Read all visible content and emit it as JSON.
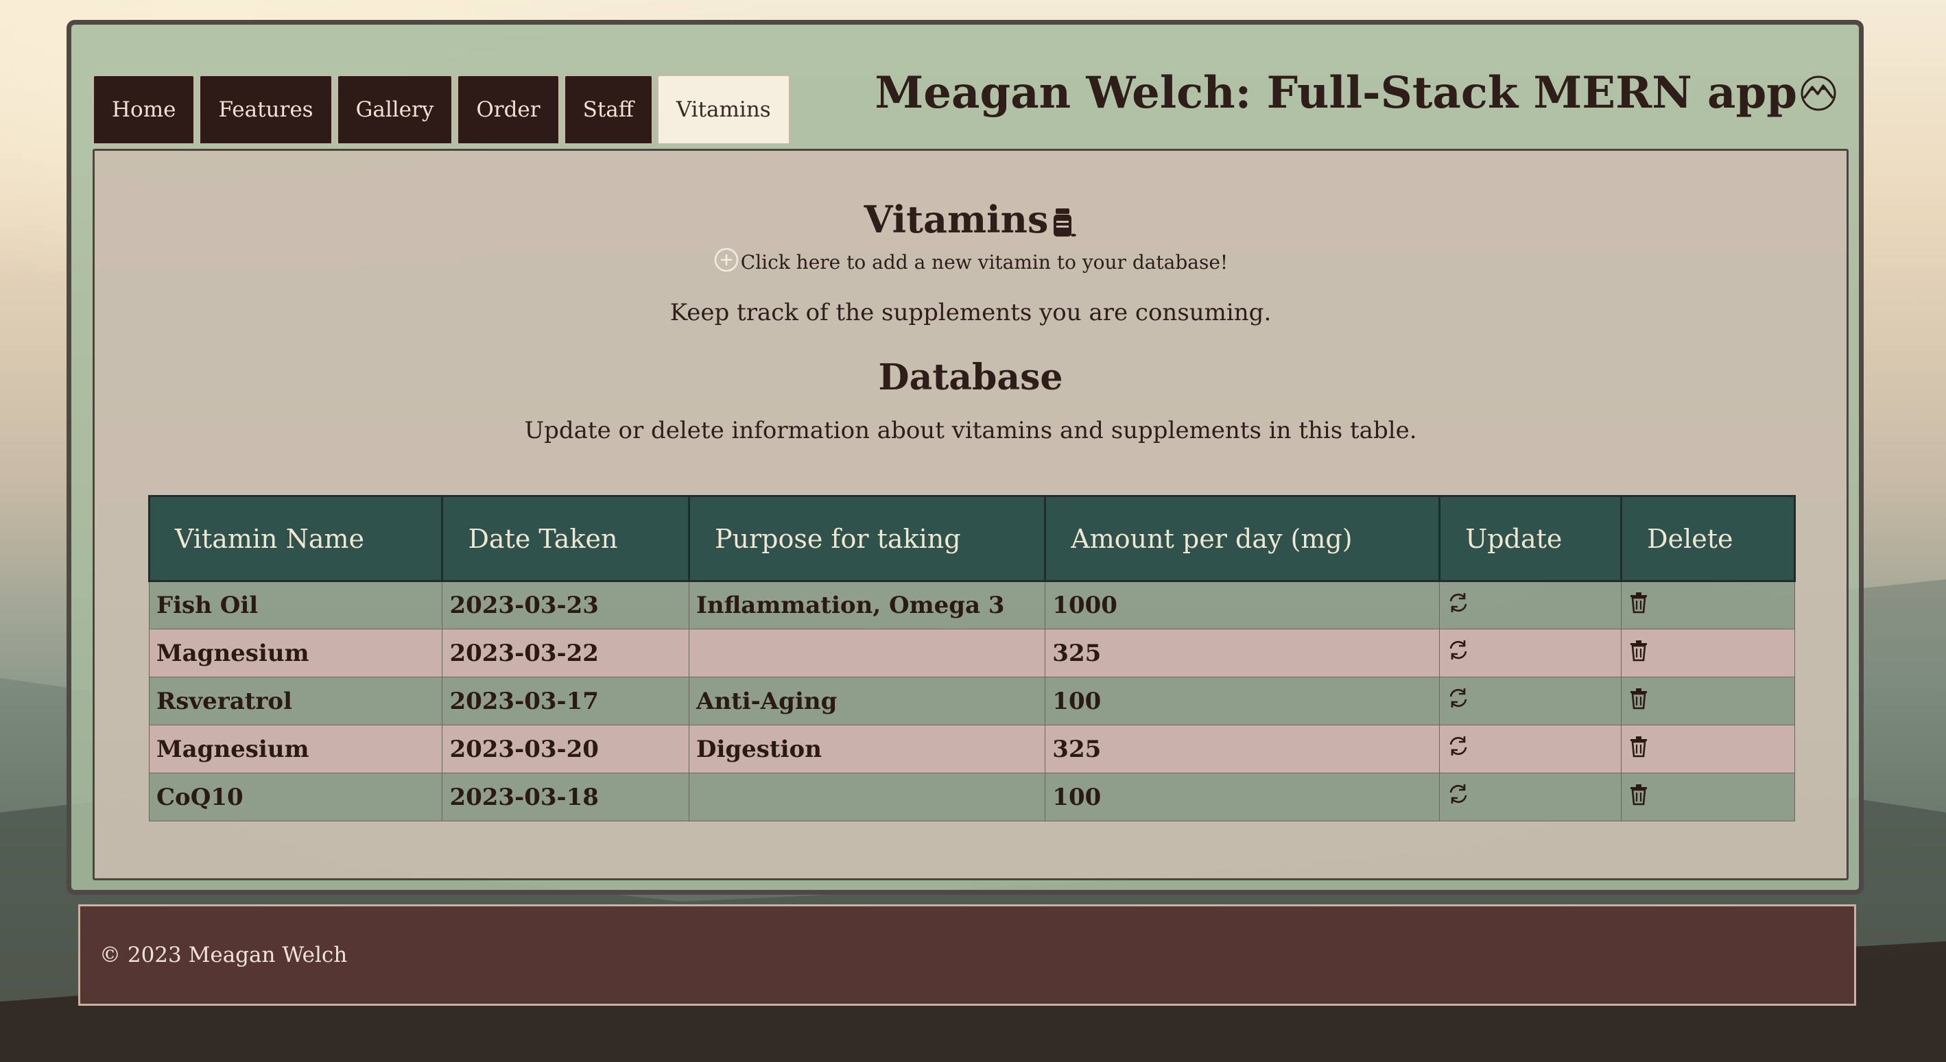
{
  "nav": {
    "tabs": [
      {
        "label": "Home"
      },
      {
        "label": "Features"
      },
      {
        "label": "Gallery"
      },
      {
        "label": "Order"
      },
      {
        "label": "Staff"
      },
      {
        "label": "Vitamins"
      }
    ],
    "active_tab": "Vitamins"
  },
  "header": {
    "title": "Meagan Welch: Full-Stack MERN app",
    "logo_icon": "mountain-logo-icon"
  },
  "vitamins": {
    "heading": "Vitamins",
    "heading_icon": "pill-bottle-icon",
    "add_link": "Click here to add a new vitamin to your database!",
    "add_icon": "plus-circle-icon",
    "subtitle": "Keep track of the supplements you are consuming."
  },
  "database": {
    "heading": "Database",
    "subtitle": "Update or delete information about vitamins and supplements in this table."
  },
  "table": {
    "columns": [
      "Vitamin Name",
      "Date Taken",
      "Purpose for taking",
      "Amount per day (mg)",
      "Update",
      "Delete"
    ],
    "rows": [
      {
        "name": "Fish Oil",
        "date": "2023-03-23",
        "purpose": "Inflammation, Omega 3",
        "amount": "1000"
      },
      {
        "name": "Magnesium",
        "date": "2023-03-22",
        "purpose": "",
        "amount": "325"
      },
      {
        "name": "Rsveratrol",
        "date": "2023-03-17",
        "purpose": "Anti-Aging",
        "amount": "100"
      },
      {
        "name": "Magnesium",
        "date": "2023-03-20",
        "purpose": "Digestion",
        "amount": "325"
      },
      {
        "name": "CoQ10",
        "date": "2023-03-18",
        "purpose": "",
        "amount": "100"
      }
    ],
    "update_icon": "refresh-icon",
    "delete_icon": "trash-icon"
  },
  "footer": {
    "text": "© 2023 Meagan Welch"
  },
  "colors": {
    "header_bg": "#2f524c",
    "tab_bg": "#2e1a16",
    "footer_bg": "#553631",
    "frame_bg": "#a6bca0"
  }
}
